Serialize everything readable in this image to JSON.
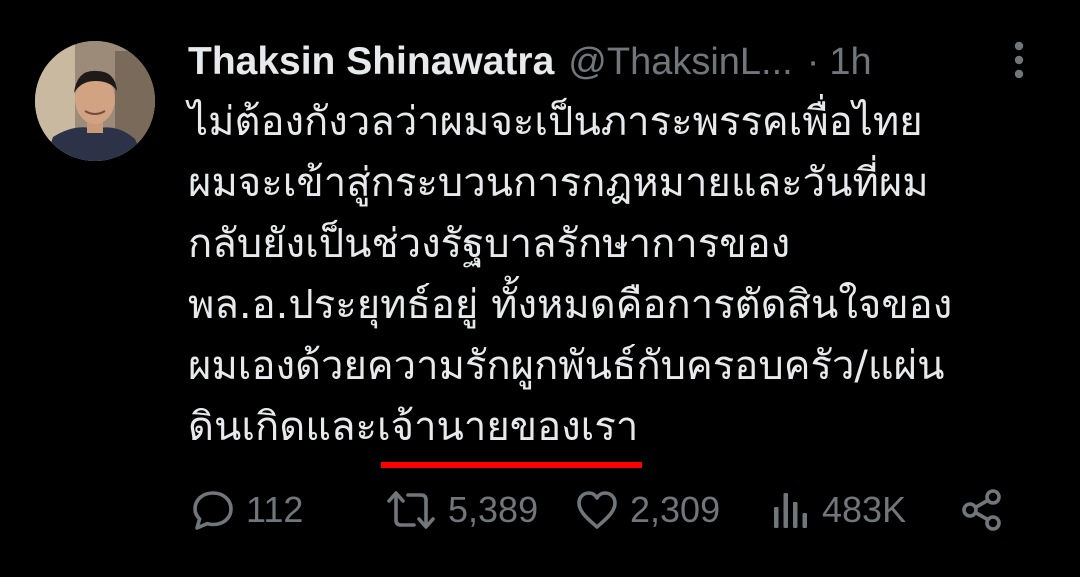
{
  "tweet": {
    "author_name": "Thaksin Shinawatra",
    "handle": "@ThaksinL...",
    "separator": "·",
    "time": "1h",
    "text_lines": [
      "ไม่ต้องกังวลว่าผมจะเป็นภาระพรรคเพื่อไทย",
      "ผมจะเข้าสู่กระบวนการกฎหมายและวันที่ผม",
      "กลับยังเป็นช่วงรัฐบาลรักษาการของ",
      "พล.อ.ประยุทธ์อยู่ ทั้งหมดคือการตัดสินใจของ",
      "ผมเองด้วยความรักผูกพันธ์กับครอบครัว/แผ่น"
    ],
    "last_line_start": "ดินเกิดและ",
    "last_line_underlined": "เจ้านายของเรา"
  },
  "actions": {
    "reply_icon": "reply-icon",
    "reply_count": "112",
    "retweet_icon": "retweet-icon",
    "retweet_count": "5,389",
    "like_icon": "heart-icon",
    "like_count": "2,309",
    "views_icon": "views-icon",
    "views_count": "483K",
    "share_icon": "share-icon"
  },
  "colors": {
    "background": "#000000",
    "primary_text": "#e7e9ea",
    "secondary_text": "#71767b",
    "underline": "#ff0000"
  }
}
